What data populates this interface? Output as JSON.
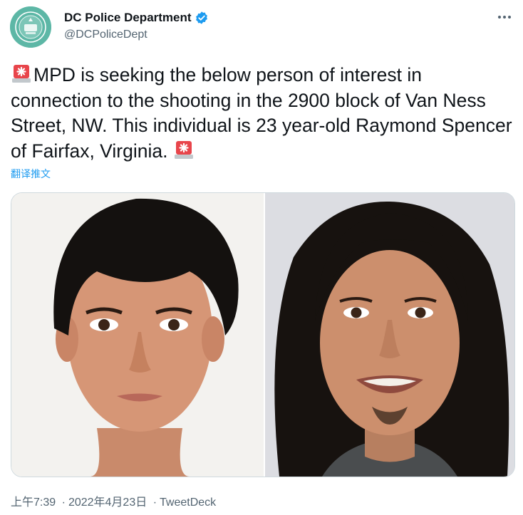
{
  "account": {
    "display_name": "DC Police Department",
    "handle": "@DCPoliceDept",
    "verified": true,
    "avatar_icon": "police-badge-icon"
  },
  "tweet": {
    "emoji_leading": "siren-icon",
    "text": "MPD is seeking the below person of interest in connection to the shooting in the 2900 block of Van Ness Street, NW. This individual is 23 year-old Raymond Spencer of Fairfax, Virginia.",
    "emoji_trailing": "siren-icon",
    "translate_label": "翻译推文"
  },
  "media": {
    "photo_count": 2
  },
  "meta": {
    "time": "上午7:39",
    "separator": "·",
    "date": "2022年4月23日",
    "source": "TweetDeck"
  },
  "colors": {
    "link": "#1d9bf0",
    "verified": "#1d9bf0",
    "secondary_text": "#536471",
    "siren_red": "#e8454b"
  }
}
